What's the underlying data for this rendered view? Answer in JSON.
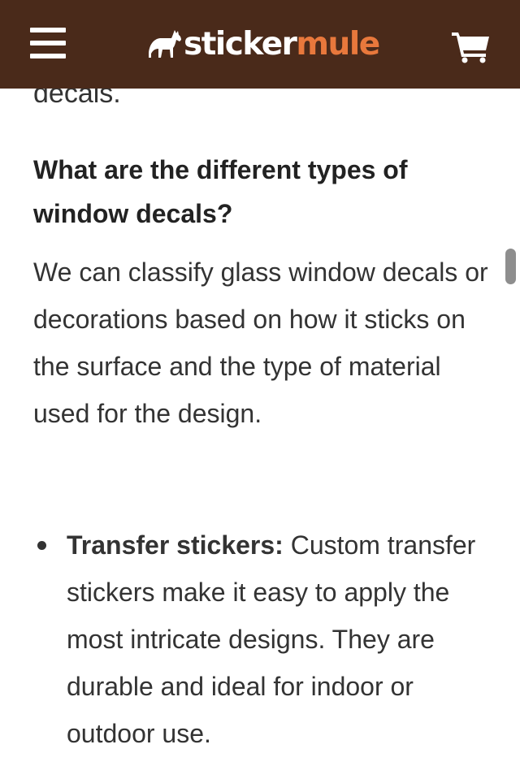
{
  "header": {
    "logo_part1": "sticker",
    "logo_part2": "mule",
    "colors": {
      "background": "#4a2a1a",
      "accent": "#e8783c"
    },
    "icons": [
      "menu-icon",
      "mule-logo-icon",
      "cart-icon"
    ]
  },
  "article": {
    "partial_text": "decals.",
    "question": "What are the different types of window decals?",
    "paragraph": "We can classify glass window decals or decorations based on how it sticks on the surface and the type of material used for the design.",
    "bullets": [
      {
        "title": "Transfer stickers:",
        "text": " Custom transfer stickers make it easy to apply the most intricate designs. They are durable and ideal for indoor or outdoor use."
      }
    ]
  }
}
